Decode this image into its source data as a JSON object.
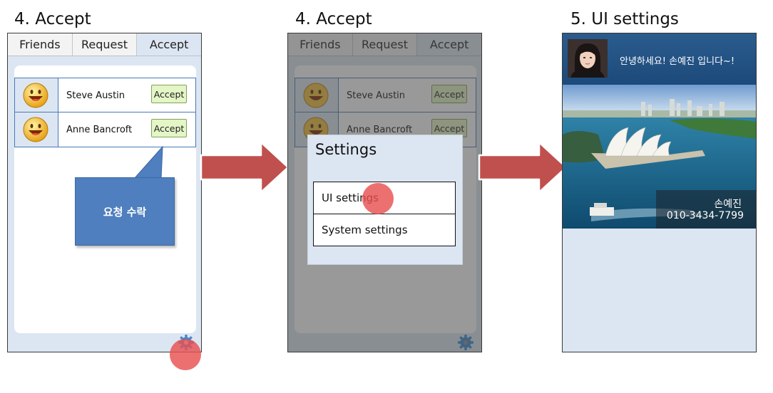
{
  "steps": [
    {
      "title": "4. Accept"
    },
    {
      "title": "4. Accept"
    },
    {
      "title": "5. UI settings"
    }
  ],
  "tabs": [
    "Friends",
    "Request",
    "Accept"
  ],
  "active_tab": "Accept",
  "friends": [
    {
      "name": "Steve Austin",
      "button": "Accept",
      "avatar": "smiley-face-icon"
    },
    {
      "name": "Anne Bancroft",
      "button": "Accept",
      "avatar": "smiley-face-icon"
    }
  ],
  "callout": {
    "text": "요청 수락"
  },
  "settings_dialog": {
    "title": "Settings",
    "items": [
      "UI settings",
      "System settings"
    ]
  },
  "ui_settings": {
    "greeting": "안녕하세요! 손예진 입니다~!",
    "name": "손예진",
    "phone": "010-3434-7799",
    "photo": "sydney-opera-house-photo"
  },
  "icons": {
    "settings": "gear-icon",
    "next": "right-arrow-icon"
  },
  "colors": {
    "tab_active": "#dce6f2",
    "list_border": "#4a78b8",
    "accept_button": "#e4f5c6",
    "callout": "#4f7fbe",
    "tap_indicator": "#e85050",
    "arrow": "#c0504d"
  }
}
